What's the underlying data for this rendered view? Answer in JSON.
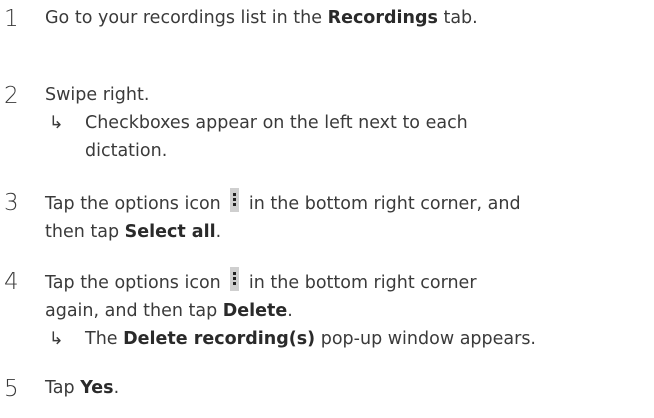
{
  "steps": [
    {
      "num": "1",
      "lines": [
        {
          "pre": "Go to your recordings list in the ",
          "bold": "Recordings",
          "post": " tab."
        }
      ]
    },
    {
      "num": "2",
      "lines": [
        {
          "text": "Swipe right."
        }
      ],
      "result": {
        "arrow": "↳",
        "lines": [
          "Checkboxes appear on the left next to each",
          "dictation."
        ]
      }
    },
    {
      "num": "3",
      "line1": {
        "pre": "Tap the options icon ",
        "post": " in the bottom right corner, and"
      },
      "line2": {
        "pre": "then tap ",
        "bold": "Select all",
        "post": "."
      }
    },
    {
      "num": "4",
      "line1": {
        "pre": "Tap the options icon ",
        "post": " in the bottom right corner"
      },
      "line2": {
        "pre": "again, and then tap ",
        "bold": "Delete",
        "post": "."
      },
      "result": {
        "arrow": "↳",
        "pre": "The ",
        "bold": "Delete recording(s)",
        "post": " pop-up window appears."
      }
    },
    {
      "num": "5",
      "line1": {
        "pre": "Tap ",
        "bold": "Yes",
        "post": "."
      }
    }
  ],
  "icons": {
    "options": "options-icon"
  }
}
